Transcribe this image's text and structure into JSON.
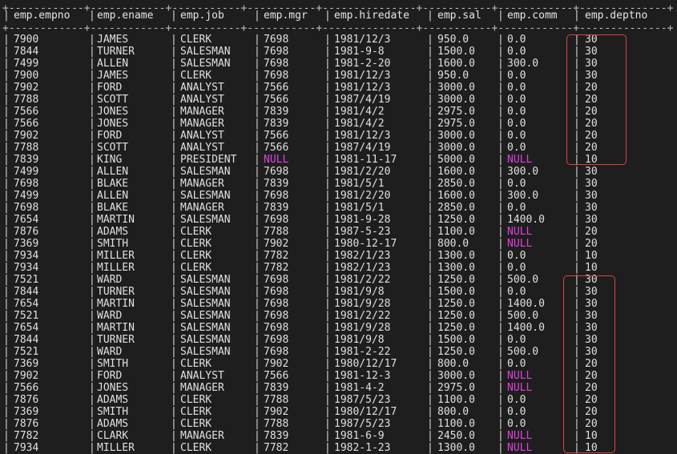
{
  "terminal": {
    "border_line": "+------------+------------+-----------+-----------+---------------+-----------+------------+--------------+",
    "columns": [
      "emp.empno",
      "emp.ename",
      "emp.job",
      "emp.mgr",
      "emp.hiredate",
      "emp.sal",
      "emp.comm",
      "emp.deptno"
    ],
    "rows": [
      [
        "7900",
        "JAMES",
        "CLERK",
        "7698",
        "1981/12/3",
        "950.0",
        "0.0",
        "30"
      ],
      [
        "7844",
        "TURNER",
        "SALESMAN",
        "7698",
        "1981-9-8",
        "1500.0",
        "0.0",
        "30"
      ],
      [
        "7499",
        "ALLEN",
        "SALESMAN",
        "7698",
        "1981-2-20",
        "1600.0",
        "300.0",
        "30"
      ],
      [
        "7900",
        "JAMES",
        "CLERK",
        "7698",
        "1981/12/3",
        "950.0",
        "0.0",
        "30"
      ],
      [
        "7902",
        "FORD",
        "ANALYST",
        "7566",
        "1981/12/3",
        "3000.0",
        "0.0",
        "20"
      ],
      [
        "7788",
        "SCOTT",
        "ANALYST",
        "7566",
        "1987/4/19",
        "3000.0",
        "0.0",
        "20"
      ],
      [
        "7566",
        "JONES",
        "MANAGER",
        "7839",
        "1981/4/2",
        "2975.0",
        "0.0",
        "20"
      ],
      [
        "7566",
        "JONES",
        "MANAGER",
        "7839",
        "1981/4/2",
        "2975.0",
        "0.0",
        "20"
      ],
      [
        "7902",
        "FORD",
        "ANALYST",
        "7566",
        "1981/12/3",
        "3000.0",
        "0.0",
        "20"
      ],
      [
        "7788",
        "SCOTT",
        "ANALYST",
        "7566",
        "1987/4/19",
        "3000.0",
        "0.0",
        "20"
      ],
      [
        "7839",
        "KING",
        "PRESIDENT",
        "NULL",
        "1981-11-17",
        "5000.0",
        "NULL",
        "10"
      ],
      [
        "7499",
        "ALLEN",
        "SALESMAN",
        "7698",
        "1981/2/20",
        "1600.0",
        "300.0",
        "30"
      ],
      [
        "7698",
        "BLAKE",
        "MANAGER",
        "7839",
        "1981/5/1",
        "2850.0",
        "0.0",
        "30"
      ],
      [
        "7499",
        "ALLEN",
        "SALESMAN",
        "7698",
        "1981/2/20",
        "1600.0",
        "300.0",
        "30"
      ],
      [
        "7698",
        "BLAKE",
        "MANAGER",
        "7839",
        "1981/5/1",
        "2850.0",
        "0.0",
        "30"
      ],
      [
        "7654",
        "MARTIN",
        "SALESMAN",
        "7698",
        "1981-9-28",
        "1250.0",
        "1400.0",
        "30"
      ],
      [
        "7876",
        "ADAMS",
        "CLERK",
        "7788",
        "1987-5-23",
        "1100.0",
        "NULL",
        "20"
      ],
      [
        "7369",
        "SMITH",
        "CLERK",
        "7902",
        "1980-12-17",
        "800.0",
        "NULL",
        "20"
      ],
      [
        "7934",
        "MILLER",
        "CLERK",
        "7782",
        "1982/1/23",
        "1300.0",
        "0.0",
        "10"
      ],
      [
        "7934",
        "MILLER",
        "CLERK",
        "7782",
        "1982/1/23",
        "1300.0",
        "0.0",
        "10"
      ],
      [
        "7521",
        "WARD",
        "SALESMAN",
        "7698",
        "1981/2/22",
        "1250.0",
        "500.0",
        "30"
      ],
      [
        "7844",
        "TURNER",
        "SALESMAN",
        "7698",
        "1981/9/8",
        "1500.0",
        "0.0",
        "30"
      ],
      [
        "7654",
        "MARTIN",
        "SALESMAN",
        "7698",
        "1981/9/28",
        "1250.0",
        "1400.0",
        "30"
      ],
      [
        "7521",
        "WARD",
        "SALESMAN",
        "7698",
        "1981/2/22",
        "1250.0",
        "500.0",
        "30"
      ],
      [
        "7654",
        "MARTIN",
        "SALESMAN",
        "7698",
        "1981/9/28",
        "1250.0",
        "1400.0",
        "30"
      ],
      [
        "7844",
        "TURNER",
        "SALESMAN",
        "7698",
        "1981/9/8",
        "1500.0",
        "0.0",
        "30"
      ],
      [
        "7521",
        "WARD",
        "SALESMAN",
        "7698",
        "1981-2-22",
        "1250.0",
        "500.0",
        "30"
      ],
      [
        "7369",
        "SMITH",
        "CLERK",
        "7902",
        "1980/12/17",
        "800.0",
        "0.0",
        "20"
      ],
      [
        "7902",
        "FORD",
        "ANALYST",
        "7566",
        "1981-12-3",
        "3000.0",
        "NULL",
        "20"
      ],
      [
        "7566",
        "JONES",
        "MANAGER",
        "7839",
        "1981-4-2",
        "2975.0",
        "NULL",
        "20"
      ],
      [
        "7876",
        "ADAMS",
        "CLERK",
        "7788",
        "1987/5/23",
        "1100.0",
        "0.0",
        "20"
      ],
      [
        "7369",
        "SMITH",
        "CLERK",
        "7902",
        "1980/12/17",
        "800.0",
        "0.0",
        "20"
      ],
      [
        "7876",
        "ADAMS",
        "CLERK",
        "7788",
        "1987/5/23",
        "1100.0",
        "0.0",
        "20"
      ],
      [
        "7782",
        "CLARK",
        "MANAGER",
        "7839",
        "1981-6-9",
        "2450.0",
        "NULL",
        "10"
      ],
      [
        "7934",
        "MILLER",
        "CLERK",
        "7782",
        "1982-1-23",
        "1300.0",
        "NULL",
        "10"
      ]
    ],
    "null_value": "NULL",
    "colors": {
      "background": "#1e1e1e",
      "text": "#e0e0e0",
      "null_text": "#e040e0",
      "highlight_border": "#d8463c"
    }
  }
}
